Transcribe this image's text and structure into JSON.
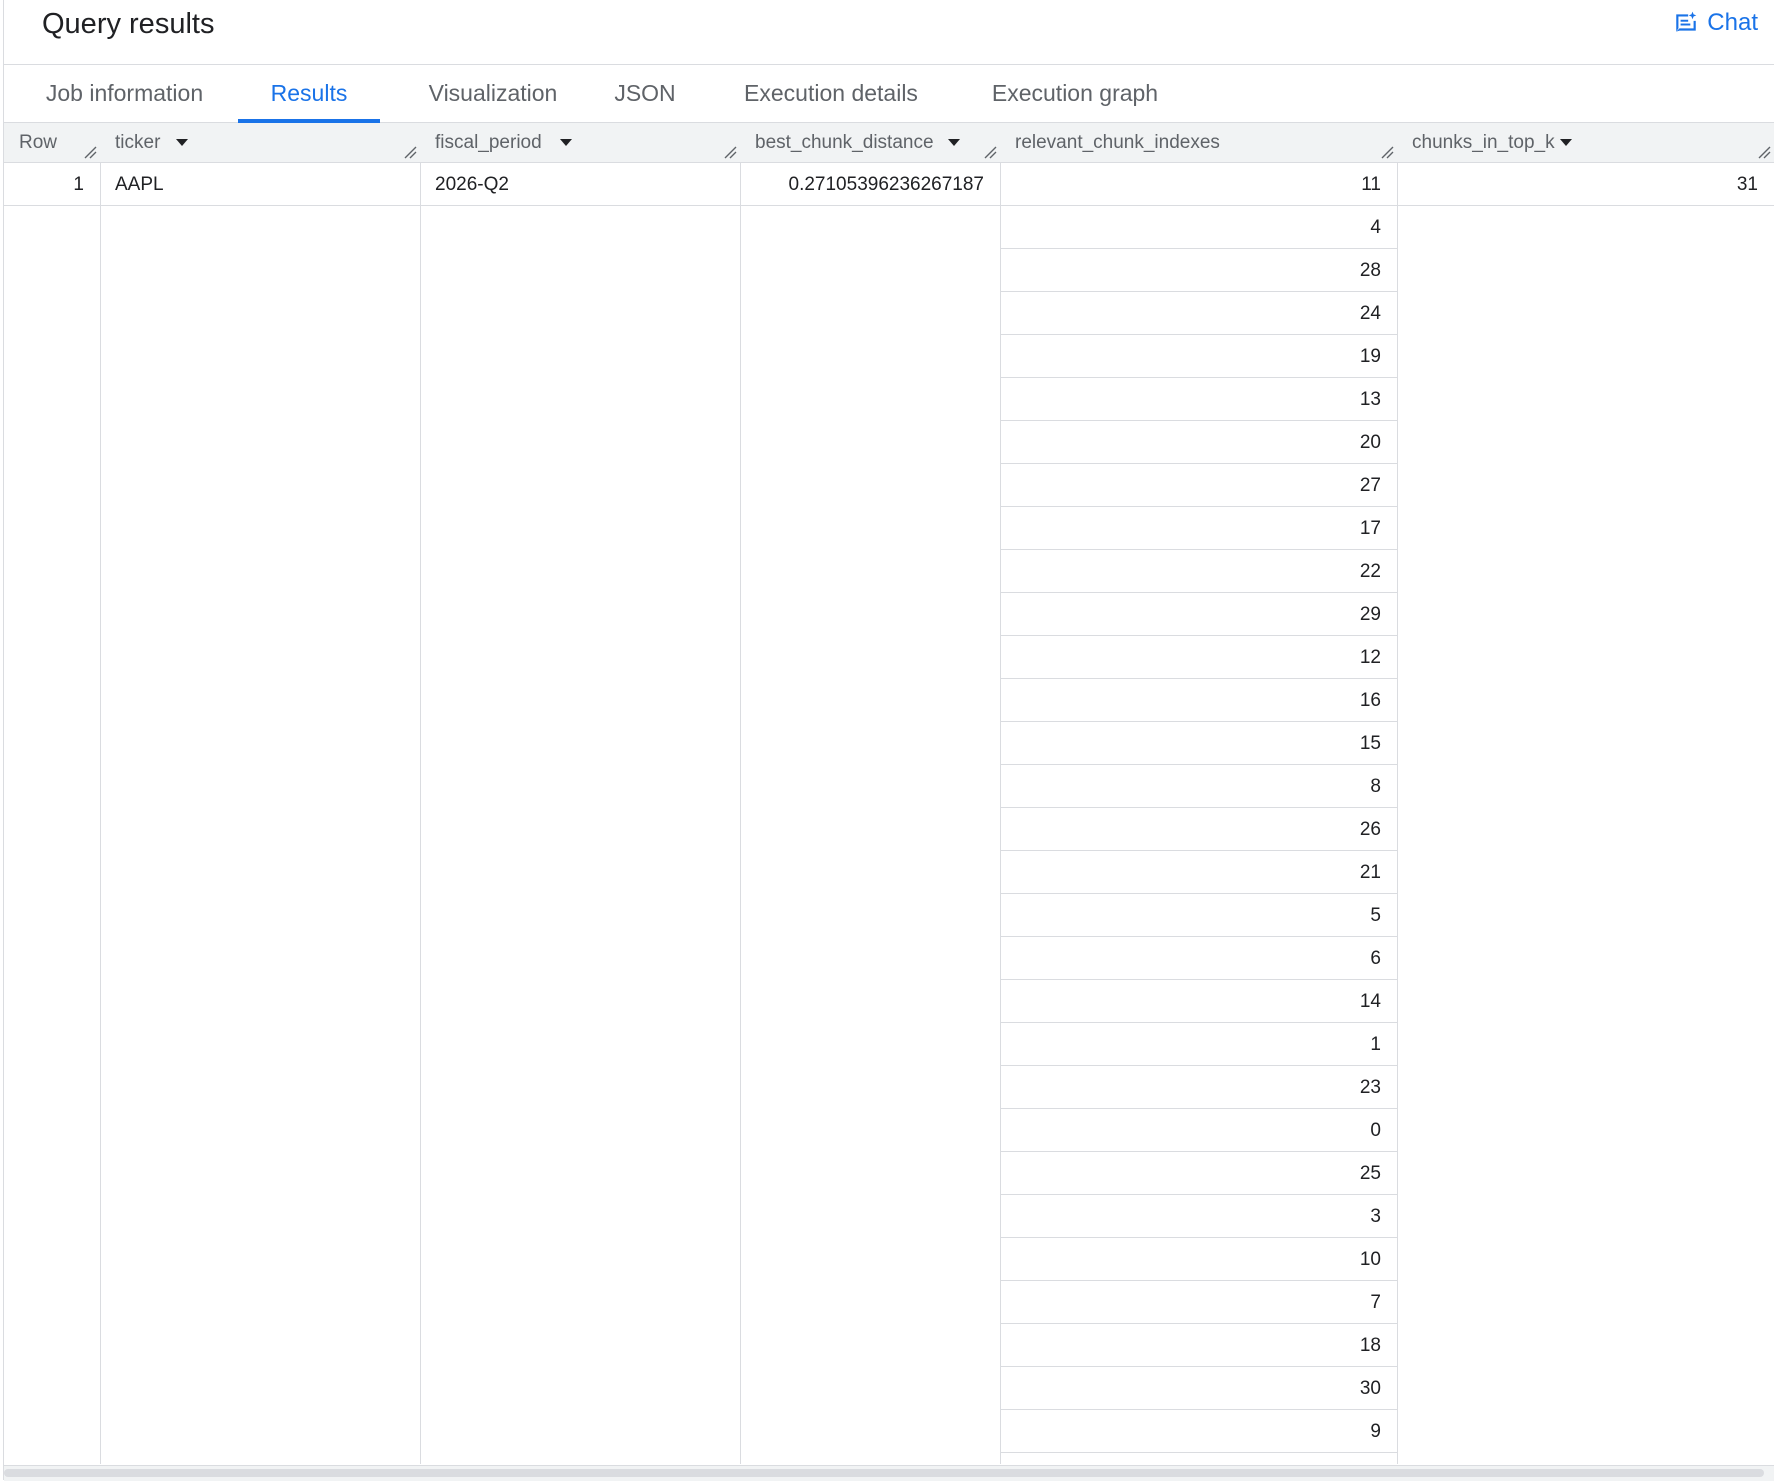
{
  "header": {
    "title": "Query results",
    "chat_label": "Chat"
  },
  "tabs": [
    {
      "label": "Job information",
      "active": false
    },
    {
      "label": "Results",
      "active": true
    },
    {
      "label": "Visualization",
      "active": false
    },
    {
      "label": "JSON",
      "active": false
    },
    {
      "label": "Execution details",
      "active": false
    },
    {
      "label": "Execution graph",
      "active": false
    }
  ],
  "columns": [
    {
      "name": "Row",
      "sortable": false
    },
    {
      "name": "ticker",
      "sortable": true
    },
    {
      "name": "fiscal_period",
      "sortable": true
    },
    {
      "name": "best_chunk_distance",
      "sortable": true
    },
    {
      "name": "relevant_chunk_indexes",
      "sortable": false
    },
    {
      "name": "chunks_in_top_k",
      "sortable": true
    }
  ],
  "rows": [
    {
      "row": "1",
      "ticker": "AAPL",
      "fiscal_period": "2026-Q2",
      "best_chunk_distance": "0.27105396236267187",
      "relevant_chunk_indexes": [
        "11",
        "4",
        "28",
        "24",
        "19",
        "13",
        "20",
        "27",
        "17",
        "22",
        "29",
        "12",
        "16",
        "15",
        "8",
        "26",
        "21",
        "5",
        "6",
        "14",
        "1",
        "23",
        "0",
        "25",
        "3",
        "10",
        "7",
        "18",
        "30",
        "9"
      ],
      "chunks_in_top_k": "31"
    }
  ],
  "colors": {
    "accent": "#1a73e8",
    "header_bg": "#f1f3f4",
    "border": "#dadce0",
    "muted_text": "#5f6368"
  }
}
